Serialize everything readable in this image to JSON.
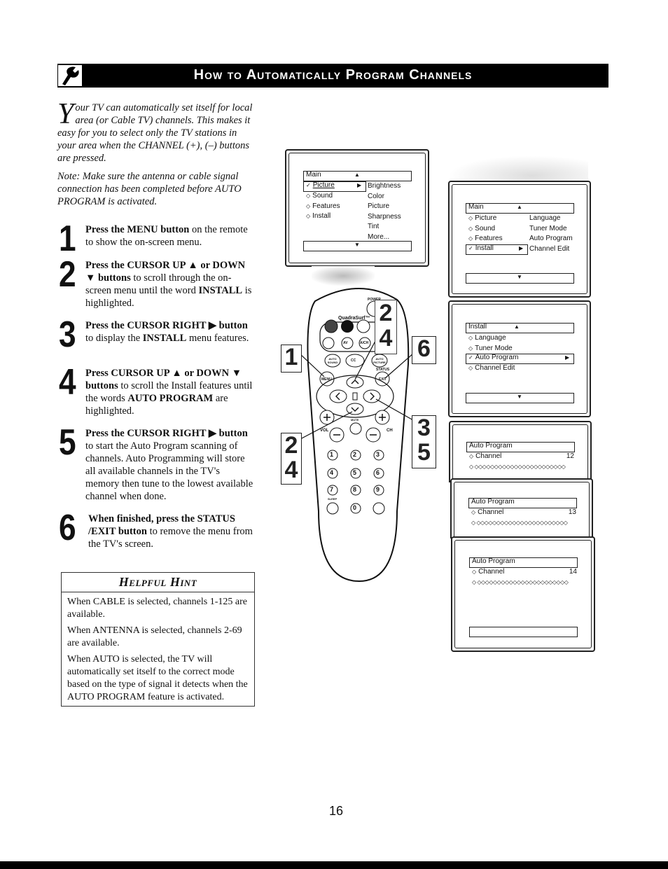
{
  "header": {
    "title": "How to Automatically Program Channels",
    "icon": "wrench-icon"
  },
  "intro": {
    "dropcap": "Y",
    "text": "our TV can automatically set itself for local area (or Cable TV) channels. This makes it easy for you to select only the TV stations in your area when the CHANNEL (+), (–) buttons are pressed."
  },
  "note": "Note: Make sure the antenna or cable signal connection has been completed before AUTO PROGRAM is activated.",
  "steps": [
    {
      "num": "1",
      "bold": "Press the MENU button",
      "rest": " on the remote to show the on-screen menu."
    },
    {
      "num": "2",
      "bold": "Press the CURSOR UP ▲ or DOWN ▼ buttons",
      "rest": " to scroll through the on-screen menu until the word ",
      "bold2": "INSTALL",
      "rest2": " is highlighted."
    },
    {
      "num": "3",
      "bold": "Press the CURSOR RIGHT ▶ button",
      "rest": " to display the ",
      "bold2": "INSTALL",
      "rest2": " menu features."
    },
    {
      "num": "4",
      "bold": "Press CURSOR UP ▲ or DOWN ▼ buttons",
      "rest": " to scroll the Install features until the words ",
      "bold2": "AUTO PROGRAM",
      "rest2": " are highlighted."
    },
    {
      "num": "5",
      "bold": "Press the CURSOR RIGHT ▶ button",
      "rest": " to start the Auto Program scanning of channels. Auto Programming will store all available channels in the TV's memory then tune to the lowest available channel when done."
    },
    {
      "num": "6",
      "bold": "When finished, press the STATUS /EXIT button",
      "rest": " to remove the menu from the TV's screen."
    }
  ],
  "hint": {
    "title": "Helpful Hint",
    "paragraphs": [
      "When CABLE is selected, channels 1-125 are available.",
      "When ANTENNA is selected, channels 2-69 are available.",
      "When AUTO is selected, the TV will automatically set itself to the correct mode based on the type of signal it detects when the AUTO PROGRAM feature is activated."
    ]
  },
  "screens": {
    "main_picture": {
      "header": "Main",
      "left": [
        {
          "label": "Picture",
          "mark": "✓",
          "selected": true
        },
        {
          "label": "Sound",
          "mark": "◇"
        },
        {
          "label": "Features",
          "mark": "◇"
        },
        {
          "label": "Install",
          "mark": "◇"
        }
      ],
      "right": [
        "Brightness",
        "Color",
        "Picture",
        "Sharpness",
        "Tint",
        "More..."
      ]
    },
    "main_install": {
      "header": "Main",
      "left": [
        {
          "label": "Picture",
          "mark": "◇"
        },
        {
          "label": "Sound",
          "mark": "◇"
        },
        {
          "label": "Features",
          "mark": "◇"
        },
        {
          "label": "Install",
          "mark": "✓",
          "selected": true
        }
      ],
      "right": [
        "Language",
        "Tuner Mode",
        "Auto Program",
        "Channel Edit"
      ]
    },
    "install": {
      "header": "Install",
      "items": [
        {
          "label": "Language",
          "mark": "◇"
        },
        {
          "label": "Tuner Mode",
          "mark": "◇"
        },
        {
          "label": "Auto Program",
          "mark": "✓",
          "selected": true
        },
        {
          "label": "Channel Edit",
          "mark": "◇"
        }
      ]
    },
    "auto_program": [
      {
        "header": "Auto Program",
        "channel_label": "Channel",
        "channel": "12",
        "progress": "◇  ◇◇◇◇◇◇◇◇◇◇◇◇◇◇◇◇◇◇◇◇◇◇◇"
      },
      {
        "header": "Auto Program",
        "channel_label": "Channel",
        "channel": "13",
        "progress": "◇  ◇◇◇◇◇◇◇◇◇◇◇◇◇◇◇◇◇◇◇◇◇◇◇"
      },
      {
        "header": "Auto Program",
        "channel_label": "Channel",
        "channel": "14",
        "progress": "◇  ◇◇◇◇◇◇◇◇◇◇◇◇◇◇◇◇◇◇◇◇◇◇◇"
      }
    ]
  },
  "remote": {
    "power": "POWER",
    "quadrasurf": "QuadraSurf™",
    "av": "AV",
    "ach": "A/CH",
    "auto_sound": "AUTO SOUND",
    "cc": "CC",
    "auto_picture": "AUTO PICTURE",
    "menu": "MENU",
    "status": "STATUS",
    "exit": "EXIT",
    "mute": "MUTE",
    "vol": "VOL",
    "ch": "CH",
    "sleep": "SLEEP",
    "digits": [
      "1",
      "2",
      "3",
      "4",
      "5",
      "6",
      "7",
      "8",
      "9",
      "0"
    ]
  },
  "callouts": {
    "step1": "1",
    "step24_top": [
      "2",
      "4"
    ],
    "step6": "6",
    "step24_left": [
      "2",
      "4"
    ],
    "step35": [
      "3",
      "5"
    ]
  },
  "page_number": "16"
}
